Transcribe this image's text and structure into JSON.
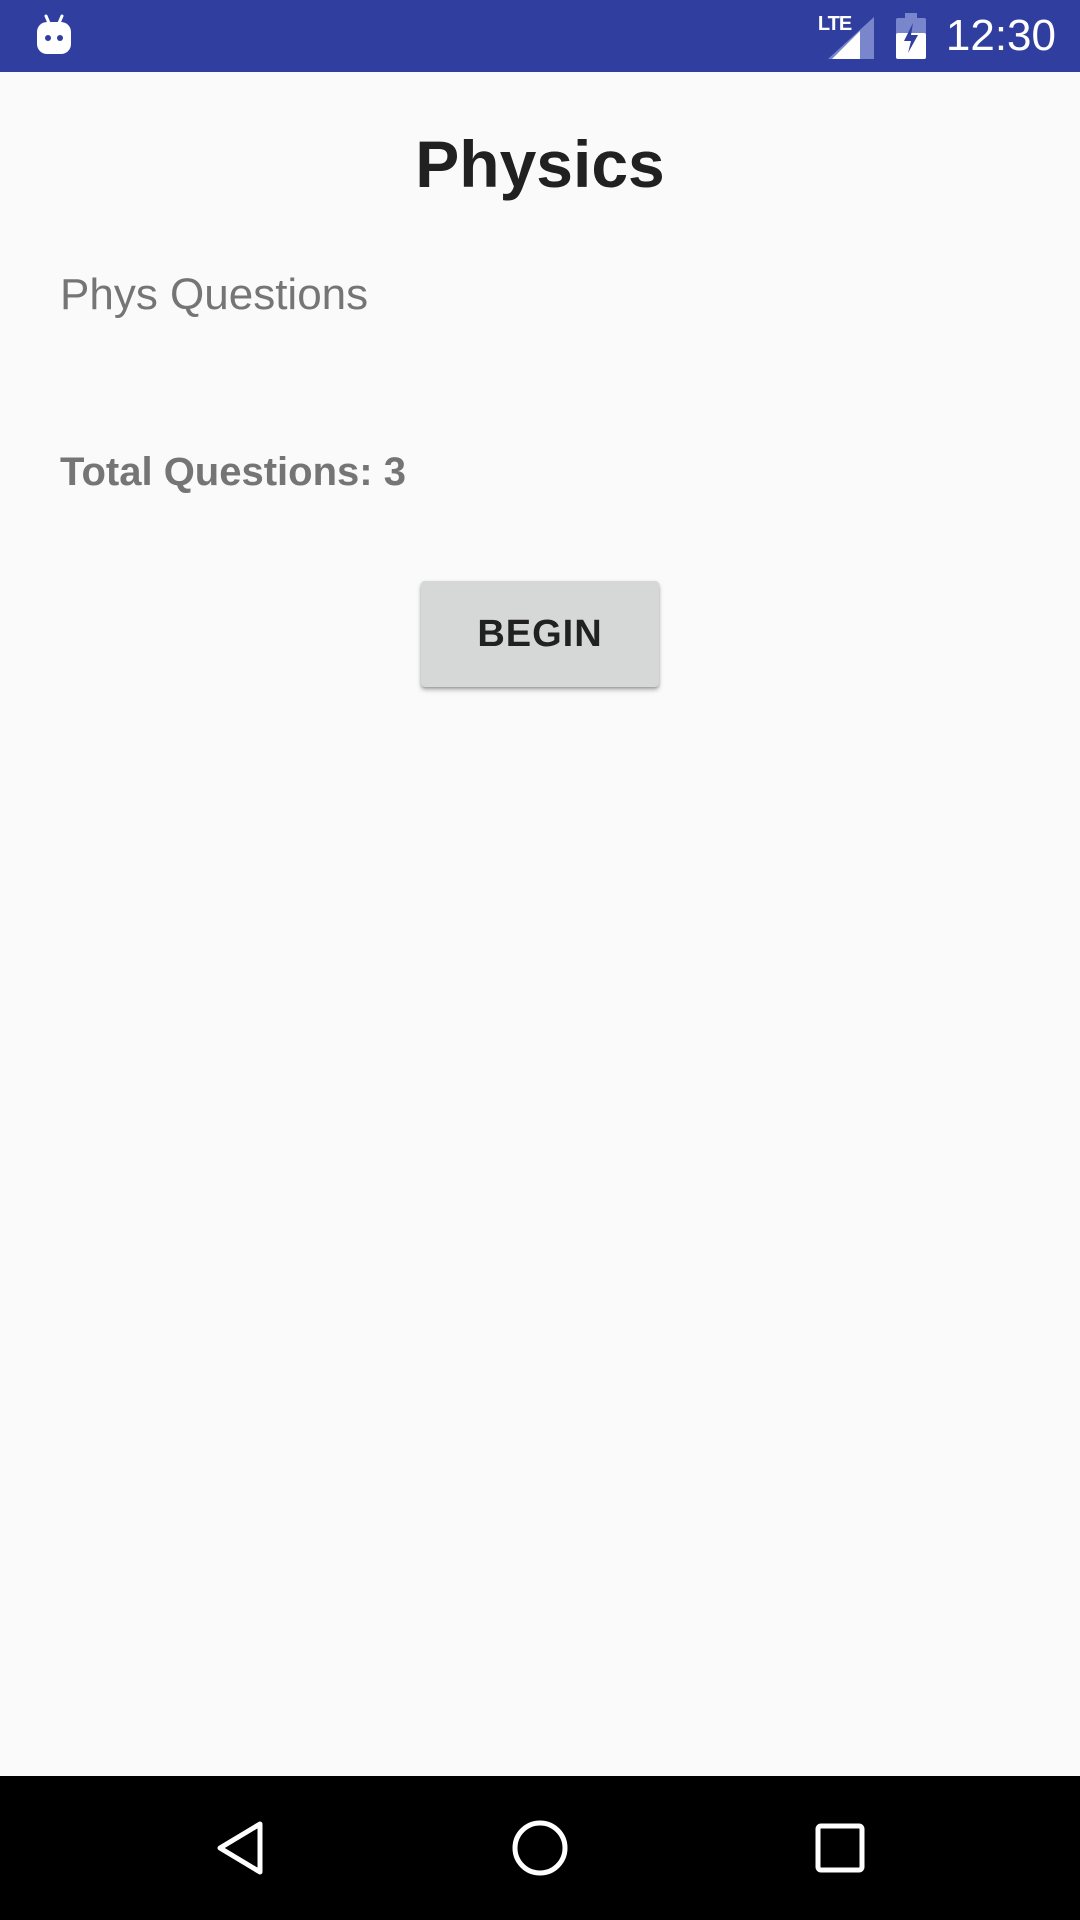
{
  "status_bar": {
    "network_type": "LTE",
    "time": "12:30",
    "icons": [
      "android-app-icon",
      "lte-signal-icon",
      "battery-charging-icon"
    ],
    "background_color": "#303f9f"
  },
  "screen": {
    "title": "Physics",
    "subtitle": "Phys Questions",
    "total_questions_text": "Total Questions: 3",
    "begin_button_label": "BEGIN"
  },
  "nav_bar": {
    "icons": [
      "back-icon",
      "home-icon",
      "recents-icon"
    ]
  }
}
